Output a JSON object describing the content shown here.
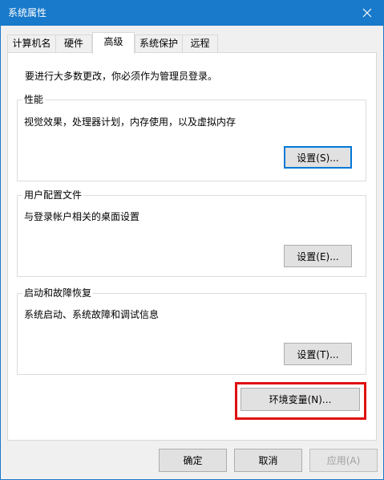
{
  "window": {
    "title": "系统属性"
  },
  "tabs": [
    {
      "label": "计算机名",
      "active": false
    },
    {
      "label": "硬件",
      "active": false
    },
    {
      "label": "高级",
      "active": true
    },
    {
      "label": "系统保护",
      "active": false
    },
    {
      "label": "远程",
      "active": false
    }
  ],
  "advanced": {
    "notice": "要进行大多数更改，你必须作为管理员登录。",
    "performance": {
      "label": "性能",
      "description": "视觉效果，处理器计划，内存使用，以及虚拟内存",
      "button": "设置(S)..."
    },
    "user_profiles": {
      "label": "用户配置文件",
      "description": "与登录帐户相关的桌面设置",
      "button": "设置(E)..."
    },
    "startup_recovery": {
      "label": "启动和故障恢复",
      "description": "系统启动、系统故障和调试信息",
      "button": "设置(T)..."
    },
    "env_button": "环境变量(N)..."
  },
  "footer": {
    "ok": "确定",
    "cancel": "取消",
    "apply": "应用(A)"
  },
  "colors": {
    "titlebar": "#1979ca",
    "focus_border": "#0078d7",
    "highlight": "#e01010"
  }
}
